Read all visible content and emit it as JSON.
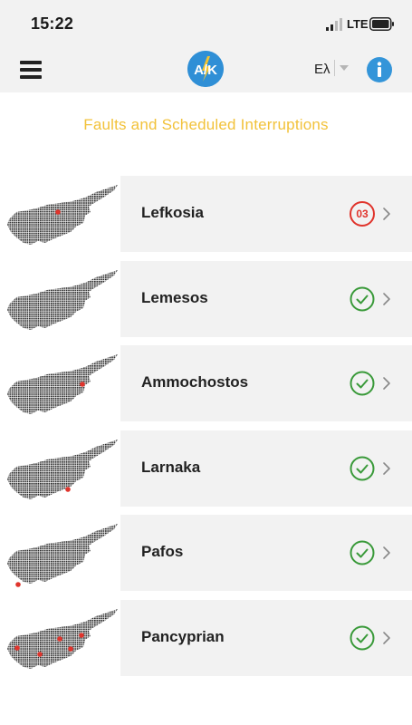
{
  "status_bar": {
    "time": "15:22",
    "network": "LTE",
    "signal_icon": "signal-icon",
    "battery_icon": "battery-icon"
  },
  "nav": {
    "menu_icon": "menu-icon",
    "logo_text": "A/K",
    "language_label": "Ελ",
    "info_icon": "info-icon"
  },
  "page": {
    "title": "Faults and Scheduled Interruptions"
  },
  "colors": {
    "title": "#f2c23a",
    "ok": "#3a9a3a",
    "fault": "#e0342c",
    "card": "#f2f2f2",
    "accent": "#2f8fd6"
  },
  "regions": [
    {
      "name": "Lefkosia",
      "status": "fault",
      "fault_count": "03"
    },
    {
      "name": "Lemesos",
      "status": "ok"
    },
    {
      "name": "Ammochostos",
      "status": "ok"
    },
    {
      "name": "Larnaka",
      "status": "ok"
    },
    {
      "name": "Pafos",
      "status": "ok"
    },
    {
      "name": "Pancyprian",
      "status": "ok"
    }
  ]
}
